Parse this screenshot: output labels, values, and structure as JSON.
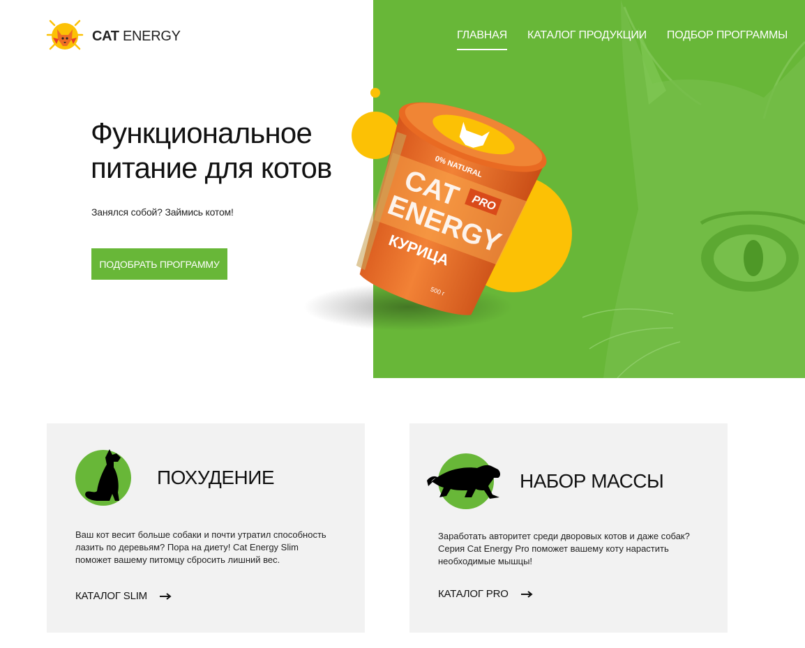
{
  "header": {
    "logo_bold": "CAT",
    "logo_light": " ENERGY",
    "nav": [
      {
        "label": "ГЛАВНАЯ",
        "active": true
      },
      {
        "label": "КАТАЛОГ ПРОДУКЦИИ",
        "active": false
      },
      {
        "label": "ПОДБОР ПРОГРАММЫ",
        "active": false
      }
    ]
  },
  "hero": {
    "title": "Функциональное питание для котов",
    "subtitle": "Занялся собой? Займись котом!",
    "button_label": "ПОДОБРАТЬ ПРОГРАММУ",
    "product": {
      "brand_line1": "CAT",
      "brand_line2": "ENERGY",
      "badge": "PRO",
      "natural": "0% NATURAL",
      "flavor": "КУРИЦА",
      "weight": "500 г"
    }
  },
  "cards": [
    {
      "title": "ПОХУДЕНИЕ",
      "text": "Ваш кот весит больше собаки и почти утратил способность лазить по деревьям? Пора на диету! Cat Energy Slim поможет вашему питомцу сбросить лишний вес.",
      "link": "КАТАЛОГ SLIM",
      "icon": "sitting-cat-icon"
    },
    {
      "title": "НАБОР МАССЫ",
      "text": "Заработать авторитет среди дворовых котов и даже собак? Серия Cat Energy Pro поможет вашему коту нарастить необходимые мышцы!",
      "link": "КАТАЛОГ PRO",
      "icon": "panther-icon"
    }
  ],
  "colors": {
    "accent_green": "#68b738",
    "accent_yellow": "#fcc105",
    "product_orange": "#ee6d26",
    "card_bg": "#f2f2f2"
  }
}
